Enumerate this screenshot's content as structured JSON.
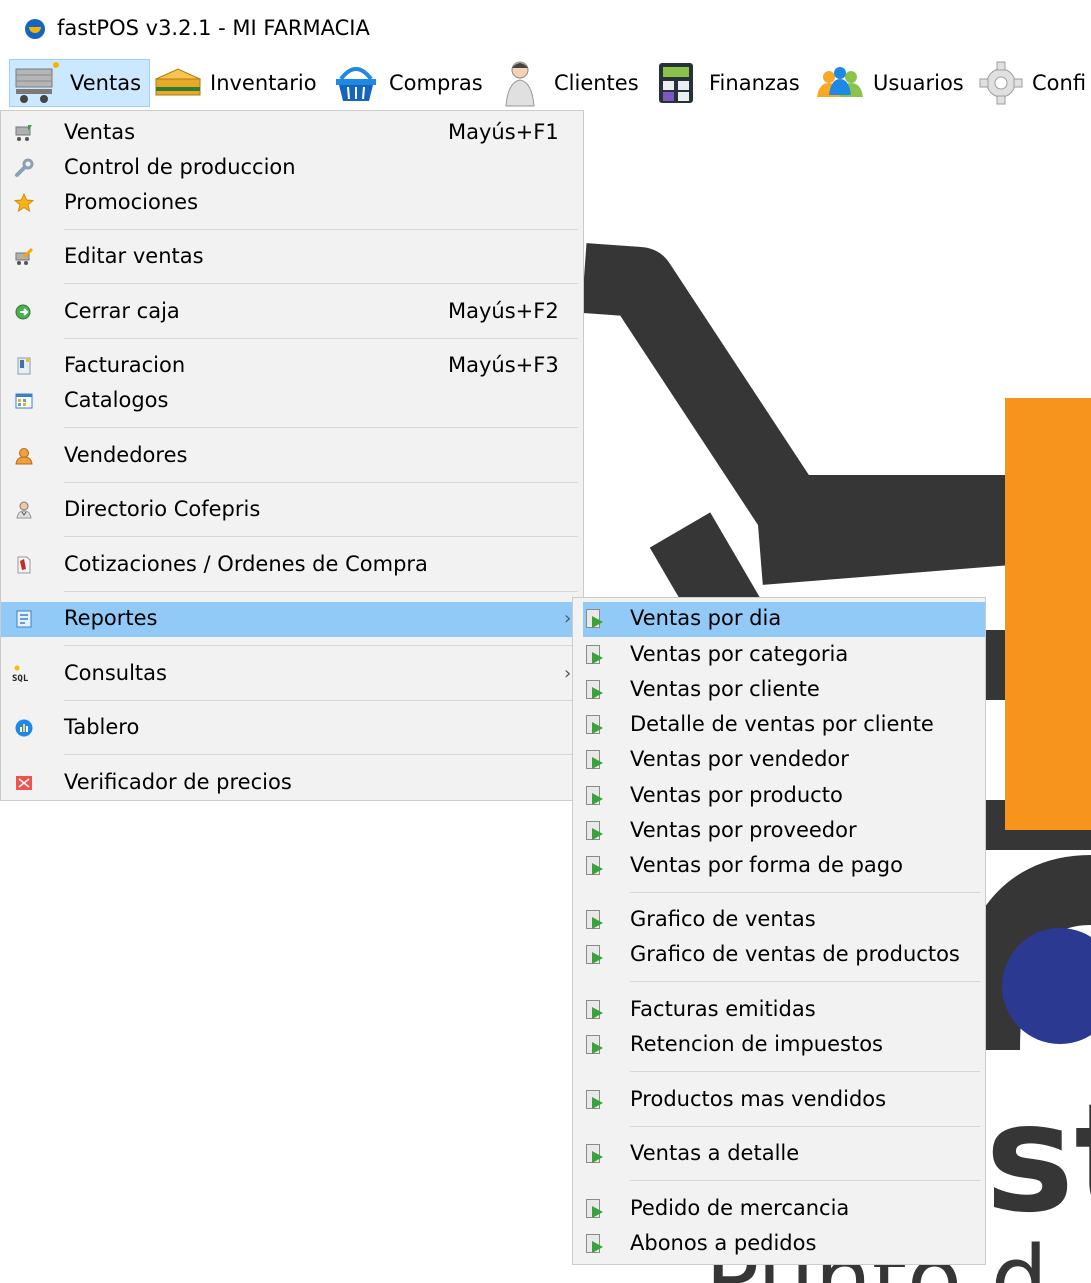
{
  "window": {
    "title": "fastPOS v3.2.1 - MI FARMACIA"
  },
  "menubar": {
    "items": [
      {
        "label": "Ventas",
        "icon": "cart-icon"
      },
      {
        "label": "Inventario",
        "icon": "box-icon"
      },
      {
        "label": "Compras",
        "icon": "basket-icon"
      },
      {
        "label": "Clientes",
        "icon": "person-icon"
      },
      {
        "label": "Finanzas",
        "icon": "calculator-icon"
      },
      {
        "label": "Usuarios",
        "icon": "users-icon"
      },
      {
        "label": "Confi",
        "icon": "gear-icon"
      }
    ]
  },
  "ventas_menu": {
    "items": [
      {
        "label": "Ventas",
        "shortcut": "Mayús+F1"
      },
      {
        "label": "Control de produccion",
        "shortcut": ""
      },
      {
        "label": "Promociones",
        "shortcut": ""
      },
      {
        "label": "Editar ventas",
        "shortcut": ""
      },
      {
        "label": "Cerrar caja",
        "shortcut": "Mayús+F2"
      },
      {
        "label": "Facturacion",
        "shortcut": "Mayús+F3"
      },
      {
        "label": "Catalogos",
        "shortcut": ""
      },
      {
        "label": "Vendedores",
        "shortcut": ""
      },
      {
        "label": "Directorio Cofepris",
        "shortcut": ""
      },
      {
        "label": "Cotizaciones / Ordenes de Compra",
        "shortcut": ""
      },
      {
        "label": "Reportes",
        "shortcut": ""
      },
      {
        "label": "Consultas",
        "shortcut": ""
      },
      {
        "label": "Tablero",
        "shortcut": ""
      },
      {
        "label": "Verificador de precios",
        "shortcut": ""
      }
    ],
    "sql_icon_text": "SQL"
  },
  "reportes_submenu": {
    "items": [
      "Ventas por dia",
      "Ventas por categoria",
      "Ventas por cliente",
      "Detalle de ventas por cliente",
      "Ventas por vendedor",
      "Ventas por producto",
      "Ventas por proveedor",
      "Ventas por forma de pago",
      "Grafico de ventas",
      "Grafico de ventas de productos",
      "Facturas emitidas",
      "Retencion de impuestos",
      "Productos mas vendidos",
      "Ventas a detalle",
      "Pedido de mercancia",
      "Abonos a pedidos"
    ]
  },
  "background_logo": {
    "text_fragment": "st",
    "bottom_fragment": "Punto d",
    "colors": {
      "dark": "#363636",
      "orange": "#f7941d",
      "blue": "#2b3990"
    }
  }
}
